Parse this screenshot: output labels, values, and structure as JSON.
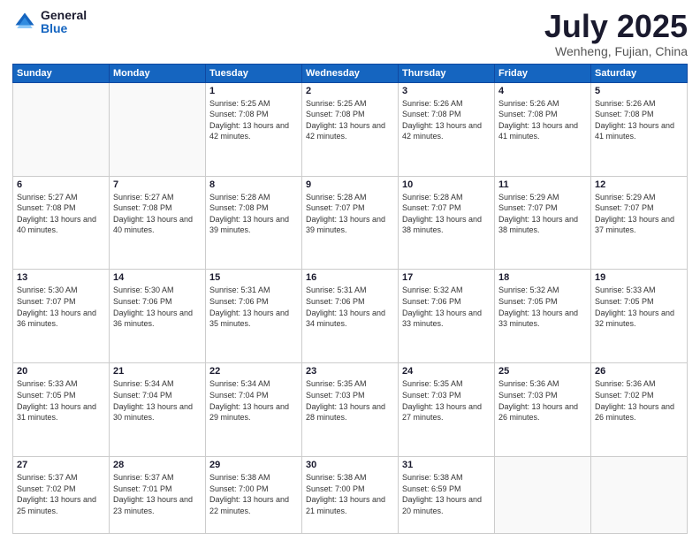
{
  "logo": {
    "general": "General",
    "blue": "Blue"
  },
  "header": {
    "month": "July 2025",
    "location": "Wenheng, Fujian, China"
  },
  "weekdays": [
    "Sunday",
    "Monday",
    "Tuesday",
    "Wednesday",
    "Thursday",
    "Friday",
    "Saturday"
  ],
  "weeks": [
    [
      {
        "day": "",
        "info": ""
      },
      {
        "day": "",
        "info": ""
      },
      {
        "day": "1",
        "info": "Sunrise: 5:25 AM\nSunset: 7:08 PM\nDaylight: 13 hours and 42 minutes."
      },
      {
        "day": "2",
        "info": "Sunrise: 5:25 AM\nSunset: 7:08 PM\nDaylight: 13 hours and 42 minutes."
      },
      {
        "day": "3",
        "info": "Sunrise: 5:26 AM\nSunset: 7:08 PM\nDaylight: 13 hours and 42 minutes."
      },
      {
        "day": "4",
        "info": "Sunrise: 5:26 AM\nSunset: 7:08 PM\nDaylight: 13 hours and 41 minutes."
      },
      {
        "day": "5",
        "info": "Sunrise: 5:26 AM\nSunset: 7:08 PM\nDaylight: 13 hours and 41 minutes."
      }
    ],
    [
      {
        "day": "6",
        "info": "Sunrise: 5:27 AM\nSunset: 7:08 PM\nDaylight: 13 hours and 40 minutes."
      },
      {
        "day": "7",
        "info": "Sunrise: 5:27 AM\nSunset: 7:08 PM\nDaylight: 13 hours and 40 minutes."
      },
      {
        "day": "8",
        "info": "Sunrise: 5:28 AM\nSunset: 7:08 PM\nDaylight: 13 hours and 39 minutes."
      },
      {
        "day": "9",
        "info": "Sunrise: 5:28 AM\nSunset: 7:07 PM\nDaylight: 13 hours and 39 minutes."
      },
      {
        "day": "10",
        "info": "Sunrise: 5:28 AM\nSunset: 7:07 PM\nDaylight: 13 hours and 38 minutes."
      },
      {
        "day": "11",
        "info": "Sunrise: 5:29 AM\nSunset: 7:07 PM\nDaylight: 13 hours and 38 minutes."
      },
      {
        "day": "12",
        "info": "Sunrise: 5:29 AM\nSunset: 7:07 PM\nDaylight: 13 hours and 37 minutes."
      }
    ],
    [
      {
        "day": "13",
        "info": "Sunrise: 5:30 AM\nSunset: 7:07 PM\nDaylight: 13 hours and 36 minutes."
      },
      {
        "day": "14",
        "info": "Sunrise: 5:30 AM\nSunset: 7:06 PM\nDaylight: 13 hours and 36 minutes."
      },
      {
        "day": "15",
        "info": "Sunrise: 5:31 AM\nSunset: 7:06 PM\nDaylight: 13 hours and 35 minutes."
      },
      {
        "day": "16",
        "info": "Sunrise: 5:31 AM\nSunset: 7:06 PM\nDaylight: 13 hours and 34 minutes."
      },
      {
        "day": "17",
        "info": "Sunrise: 5:32 AM\nSunset: 7:06 PM\nDaylight: 13 hours and 33 minutes."
      },
      {
        "day": "18",
        "info": "Sunrise: 5:32 AM\nSunset: 7:05 PM\nDaylight: 13 hours and 33 minutes."
      },
      {
        "day": "19",
        "info": "Sunrise: 5:33 AM\nSunset: 7:05 PM\nDaylight: 13 hours and 32 minutes."
      }
    ],
    [
      {
        "day": "20",
        "info": "Sunrise: 5:33 AM\nSunset: 7:05 PM\nDaylight: 13 hours and 31 minutes."
      },
      {
        "day": "21",
        "info": "Sunrise: 5:34 AM\nSunset: 7:04 PM\nDaylight: 13 hours and 30 minutes."
      },
      {
        "day": "22",
        "info": "Sunrise: 5:34 AM\nSunset: 7:04 PM\nDaylight: 13 hours and 29 minutes."
      },
      {
        "day": "23",
        "info": "Sunrise: 5:35 AM\nSunset: 7:03 PM\nDaylight: 13 hours and 28 minutes."
      },
      {
        "day": "24",
        "info": "Sunrise: 5:35 AM\nSunset: 7:03 PM\nDaylight: 13 hours and 27 minutes."
      },
      {
        "day": "25",
        "info": "Sunrise: 5:36 AM\nSunset: 7:03 PM\nDaylight: 13 hours and 26 minutes."
      },
      {
        "day": "26",
        "info": "Sunrise: 5:36 AM\nSunset: 7:02 PM\nDaylight: 13 hours and 26 minutes."
      }
    ],
    [
      {
        "day": "27",
        "info": "Sunrise: 5:37 AM\nSunset: 7:02 PM\nDaylight: 13 hours and 25 minutes."
      },
      {
        "day": "28",
        "info": "Sunrise: 5:37 AM\nSunset: 7:01 PM\nDaylight: 13 hours and 23 minutes."
      },
      {
        "day": "29",
        "info": "Sunrise: 5:38 AM\nSunset: 7:00 PM\nDaylight: 13 hours and 22 minutes."
      },
      {
        "day": "30",
        "info": "Sunrise: 5:38 AM\nSunset: 7:00 PM\nDaylight: 13 hours and 21 minutes."
      },
      {
        "day": "31",
        "info": "Sunrise: 5:38 AM\nSunset: 6:59 PM\nDaylight: 13 hours and 20 minutes."
      },
      {
        "day": "",
        "info": ""
      },
      {
        "day": "",
        "info": ""
      }
    ]
  ]
}
